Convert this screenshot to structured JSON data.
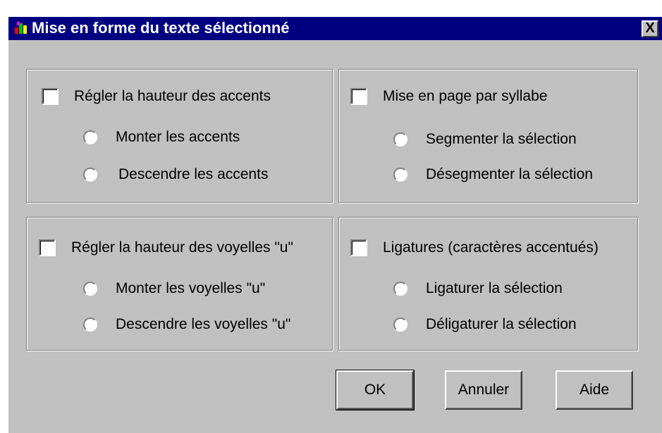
{
  "window": {
    "title": "Mise en forme du texte sélectionné",
    "close_label": "X"
  },
  "groups": [
    {
      "checkbox_label": "Régler la hauteur des accents",
      "checked": false,
      "options": [
        "Monter les accents",
        "Descendre les accents"
      ]
    },
    {
      "checkbox_label": "Mise en page par syllabe",
      "checked": false,
      "options": [
        "Segmenter la sélection",
        "Désegmenter la sélection"
      ]
    },
    {
      "checkbox_label": "Régler la hauteur des voyelles \"u\"",
      "checked": false,
      "options": [
        "Monter les voyelles \"u\"",
        "Descendre les voyelles \"u\""
      ]
    },
    {
      "checkbox_label": "Ligatures (caractères accentués)",
      "checked": false,
      "options": [
        "Ligaturer la sélection",
        "Déligaturer la sélection"
      ]
    }
  ],
  "buttons": {
    "ok": "OK",
    "cancel": "Annuler",
    "help": "Aide"
  },
  "colors": {
    "titlebar": "#000080",
    "face": "#c0c0c0"
  }
}
